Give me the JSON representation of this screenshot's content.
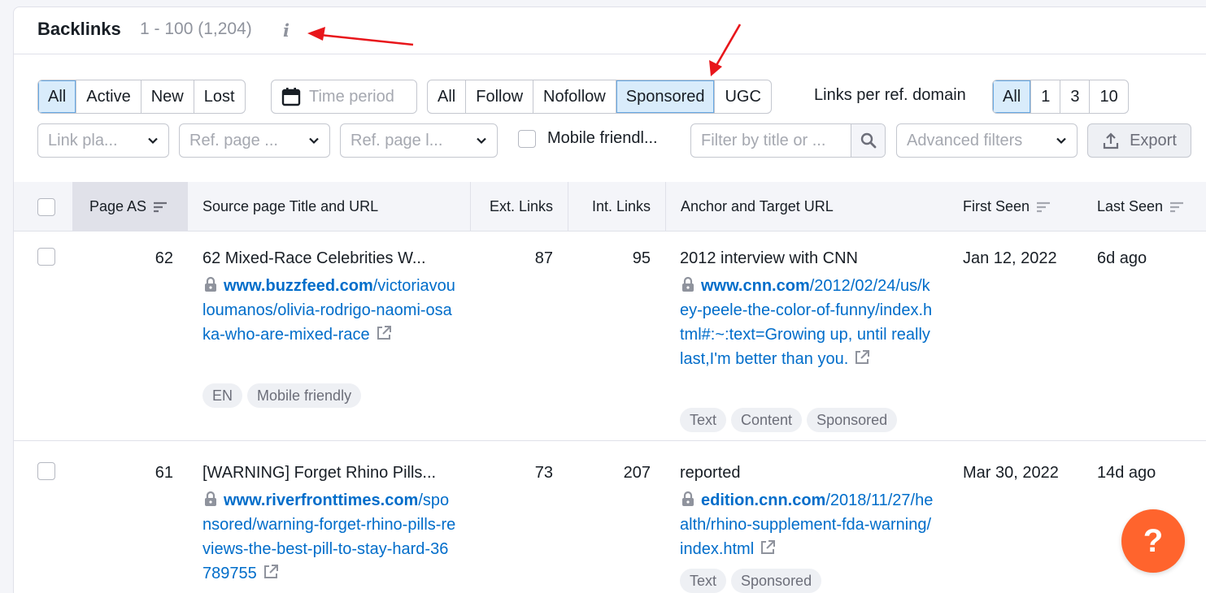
{
  "header": {
    "title": "Backlinks",
    "count": "1 - 100 (1,204)",
    "info_icon": "i"
  },
  "filters": {
    "status": [
      "All",
      "Active",
      "New",
      "Lost"
    ],
    "time_period": "Time period",
    "link_type": [
      "All",
      "Follow",
      "Nofollow",
      "Sponsored",
      "UGC"
    ],
    "links_per_ref_domain_label": "Links per ref. domain",
    "links_per_ref_domain": [
      "All",
      "1",
      "3",
      "10"
    ],
    "link_placement": "Link pla...",
    "ref_page_a": "Ref. page ...",
    "ref_page_b": "Ref. page l...",
    "mobile_friendly": "Mobile friendl...",
    "search_placeholder": "Filter by title or ...",
    "advanced_filters": "Advanced filters",
    "export": "Export"
  },
  "table": {
    "columns": {
      "page_as": "Page AS",
      "source": "Source page Title and URL",
      "ext_links": "Ext. Links",
      "int_links": "Int. Links",
      "anchor": "Anchor and Target URL",
      "first_seen": "First Seen",
      "last_seen": "Last Seen"
    },
    "rows": [
      {
        "page_as": "62",
        "source_title": "62 Mixed-Race Celebrities W...",
        "source_domain": "www.buzzfeed.com",
        "source_path": "/victoriavouloumanos/olivia-rodrigo-naomi-osaka-who-are-mixed-race",
        "source_tags": [
          "EN",
          "Mobile friendly"
        ],
        "ext_links": "87",
        "int_links": "95",
        "anchor": "2012 interview with CNN",
        "target_domain": "www.cnn.com",
        "target_path": "/2012/02/24/us/key-peele-the-color-of-funny/index.html#:~:text=Growing up, until really last,I'm better than you.",
        "target_tags": [
          "Text",
          "Content",
          "Sponsored"
        ],
        "first_seen": "Jan 12, 2022",
        "last_seen": "6d ago"
      },
      {
        "page_as": "61",
        "source_title": "[WARNING] Forget Rhino Pills...",
        "source_domain": "www.riverfronttimes.com",
        "source_path": "/sponsored/warning-forget-rhino-pills-reviews-the-best-pill-to-stay-hard-36789755",
        "source_tags": [],
        "ext_links": "73",
        "int_links": "207",
        "anchor": "reported",
        "target_domain": "edition.cnn.com",
        "target_path": "/2018/11/27/health/rhino-supplement-fda-warning/index.html",
        "target_tags": [
          "Text",
          "Sponsored"
        ],
        "first_seen": "Mar 30, 2022",
        "last_seen": "14d ago"
      }
    ]
  },
  "help_button": "?",
  "colors": {
    "accent_blue": "#006dca",
    "active_segment": "#d9ecfb",
    "help_orange": "#ff642d",
    "annotation_arrow": "#e8161b"
  }
}
